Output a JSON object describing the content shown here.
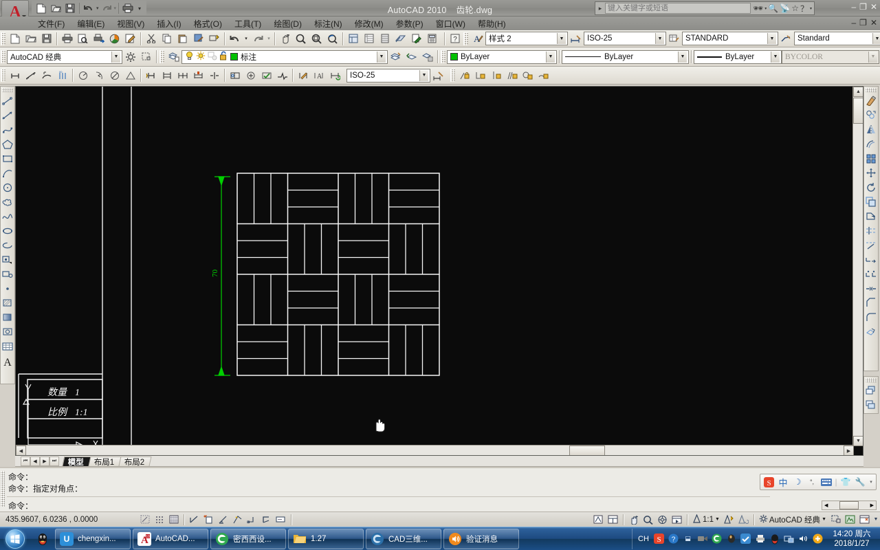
{
  "window": {
    "app_title": "AutoCAD 2010",
    "document_name": "齿轮.dwg",
    "minimize": "–",
    "maximize": "❐",
    "close": "✕",
    "doc_minimize": "–",
    "doc_maximize": "❐",
    "doc_close": "✕"
  },
  "search": {
    "placeholder": "键入关键字或短语",
    "value": "",
    "caret": "▸",
    "icons": [
      "binoculars-icon",
      "wrench-icon",
      "satellite-icon",
      "star-icon",
      "help-icon"
    ]
  },
  "quick_access": [
    {
      "name": "new-file-icon",
      "glyph": "🗋"
    },
    {
      "name": "open-file-icon",
      "glyph": "🗁"
    },
    {
      "name": "save-file-icon",
      "glyph": "🖫"
    },
    {
      "name": "undo-icon",
      "glyph": "↶"
    },
    {
      "name": "redo-icon",
      "glyph": "↷"
    },
    {
      "name": "plot-icon",
      "glyph": "🖨"
    },
    {
      "name": "qat-dropdown-icon",
      "glyph": "▾"
    }
  ],
  "menu": [
    "文件(F)",
    "编辑(E)",
    "视图(V)",
    "插入(I)",
    "格式(O)",
    "工具(T)",
    "绘图(D)",
    "标注(N)",
    "修改(M)",
    "参数(P)",
    "窗口(W)",
    "帮助(H)"
  ],
  "standard_toolbar": [
    "new-icon",
    "open-icon",
    "save-icon",
    "plot-icon",
    "preview-icon",
    "publish-icon",
    "3dprint-icon",
    "markup-icon",
    "cut-icon",
    "copy-icon",
    "paste-icon",
    "matchprop-icon",
    "blockeditor-icon",
    "undo-icon",
    "redo-icon",
    "pan-icon",
    "zoom-realtime-icon",
    "zoom-window-icon",
    "zoom-previous-icon",
    "properties-icon",
    "designcenter-icon",
    "toolpalettes-icon",
    "sheetset-icon",
    "markupset-icon",
    "calculator-icon"
  ],
  "workspace": {
    "label": "AutoCAD 经典",
    "settings_icon": "gear-icon",
    "toolbar_lock_icon": "lock-toolbar-icon"
  },
  "layer": {
    "layer_props_icon": "layer-properties-icon",
    "on_icon": "lightbulb-icon",
    "freeze_icon": "sun-icon",
    "freeze_vp_icon": "freeze-vp-icon",
    "lock_icon": "unlock-icon",
    "color_swatch": "#00c000",
    "name": "标注",
    "make_current_icon": "make-layer-current-icon",
    "previous_icon": "layer-previous-icon",
    "state_icon": "layer-state-icon"
  },
  "properties": {
    "help_icon": "help-small-icon",
    "text_style": {
      "icon": "text-style-icon",
      "value": "样式 2"
    },
    "dim_style": {
      "icon": "dim-style-icon",
      "value": "ISO-25"
    },
    "table_style": {
      "icon": "table-style-icon",
      "value": "STANDARD"
    },
    "multileader_style": {
      "icon": "mleader-style-icon",
      "value": "Standard"
    },
    "color": {
      "swatch": "#00c000",
      "value": "ByLayer"
    },
    "linetype": {
      "value": "ByLayer"
    },
    "lineweight": {
      "value": "ByLayer"
    },
    "plotstyle": {
      "value": "BYCOLOR",
      "disabled": true
    }
  },
  "dimension_toolbar": {
    "icons": [
      "linear-dim-icon",
      "aligned-dim-icon",
      "arclength-dim-icon",
      "ordinate-dim-icon",
      "radius-dim-icon",
      "jogged-dim-icon",
      "diameter-dim-icon",
      "angular-dim-icon",
      "quick-dim-icon",
      "baseline-dim-icon",
      "continue-dim-icon",
      "dimspace-icon",
      "dimbreak-icon",
      "tolerance-icon",
      "center-mark-icon",
      "inspect-icon",
      "jogline-icon",
      "dimedit-icon",
      "dimtedit-icon",
      "dimupdate-icon"
    ],
    "style_value": "ISO-25",
    "dimstyle_mgr_icon": "dimstyle-manager-icon"
  },
  "constraint_toolbar": [
    "auto-constrain-icon",
    "perpendicular-constraint-icon",
    "vertical-constraint-icon",
    "parallel-constraint-icon",
    "tangent-constraint-icon",
    "smooth-constraint-icon"
  ],
  "draw_toolbar": [
    "line-icon",
    "construction-line-icon",
    "polyline-icon",
    "polygon-icon",
    "rectangle-icon",
    "arc-icon",
    "circle-icon",
    "revcloud-icon",
    "spline-icon",
    "ellipse-icon",
    "ellipse-arc-icon",
    "insert-block-icon",
    "make-block-icon",
    "point-icon",
    "hatch-icon",
    "gradient-icon",
    "region-icon",
    "table-icon",
    "multiline-text-icon"
  ],
  "modify_toolbar": [
    "erase-icon",
    "copy-icon",
    "mirror-icon",
    "offset-icon",
    "array-icon",
    "move-icon",
    "rotate-icon",
    "scale-icon",
    "stretch-icon",
    "trim-icon",
    "extend-icon",
    "break-at-point-icon",
    "break-icon",
    "join-icon",
    "chamfer-icon",
    "fillet-icon",
    "explode-icon"
  ],
  "modify2_toolbar": [
    "draworder-front-icon",
    "draworder-back-icon"
  ],
  "drawing": {
    "dimension_label": "70",
    "dimension_color": "#00dd00",
    "title_block": {
      "row1_label": "数量",
      "row1_value": "1",
      "row2_label": "比例",
      "row2_value": "1:1"
    },
    "ucs_icon": "ucs-wcs-icon",
    "cursor": "pan-hand-cursor",
    "pattern": {
      "type": "parquet-basketweave",
      "grid": 4,
      "strips_per_cell": 3
    }
  },
  "model_tabs": {
    "nav": [
      "⏮",
      "◀",
      "▶",
      "⏭"
    ],
    "tabs": [
      {
        "label": "模型",
        "active": true
      },
      {
        "label": "布局1",
        "active": false
      },
      {
        "label": "布局2",
        "active": false
      }
    ]
  },
  "command_window": {
    "lines": [
      "命令：",
      "命令：指定对角点："
    ],
    "prompt": "命令："
  },
  "ime": {
    "items": [
      "sogou-logo-icon",
      "中",
      "moon-icon",
      "punctuation-icon",
      "keyboard-icon",
      "divider",
      "skin-icon",
      "toolbox-icon"
    ],
    "chinese_label": "中"
  },
  "status_bar": {
    "coordinates": "435.9607,  6.0236  ,  0.0000",
    "toggles": [
      "infer-constraints-icon",
      "snap-mode-icon",
      "grid-display-icon",
      "ortho-mode-icon",
      "polar-tracking-icon",
      "object-snap-icon",
      "3d-object-snap-icon",
      "object-snap-tracking-icon",
      "dynamic-ucs-icon",
      "dynamic-input-icon",
      "lineweight-icon",
      "quick-properties-icon"
    ],
    "layout_icons": [
      "model-space-icon",
      "quick-view-layouts-icon",
      "quick-view-drawings-icon"
    ],
    "view_icons": [
      "pan-icon",
      "zoom-icon",
      "steering-wheel-icon",
      "showmotion-icon"
    ],
    "annotation_scale": "1:1",
    "annotation_icons": [
      "annotation-visibility-icon",
      "auto-scale-icon"
    ],
    "workspace_label": "AutoCAD 经典",
    "right_icons": [
      "toolbar-lock-icon",
      "hardware-accel-icon",
      "clean-screen-icon",
      "status-menu-icon"
    ]
  },
  "taskbar": {
    "start_button": "windows-start-orb",
    "quick_launch": [
      {
        "name": "qq-icon",
        "glyph": "🐧"
      }
    ],
    "items": [
      {
        "label": "chengxin...",
        "icon": "chengxin-icon",
        "color": "#2d8fd8",
        "glyph": "U"
      },
      {
        "label": "AutoCAD...",
        "icon": "autocad-icon",
        "color": "#ffffff",
        "glyph": "A"
      },
      {
        "label": "密西西设...",
        "icon": "edge-browser-icon",
        "color": "#ffffff",
        "glyph": "e"
      },
      {
        "label": "1.27",
        "icon": "folder-icon",
        "color": "#f3c04a",
        "glyph": "📁"
      },
      {
        "label": "CAD三维...",
        "icon": "cad3d-icon",
        "color": "#2b6fa8",
        "glyph": "e"
      },
      {
        "label": "验证消息",
        "icon": "sound-message-icon",
        "color": "#f08a1e",
        "glyph": "🔊"
      }
    ],
    "tray": {
      "language": "CH",
      "icons": [
        "sogou-s-icon",
        "question-icon",
        "tray-expand-icon",
        "camera-icon",
        "edge-icon",
        "coffee-icon",
        "greenshot-icon",
        "printer-icon",
        "qq-tray-icon",
        "network-icon",
        "volume-icon",
        "update-icon"
      ],
      "clock_time": "14:20 周六",
      "clock_date": "2018/1/27"
    }
  }
}
